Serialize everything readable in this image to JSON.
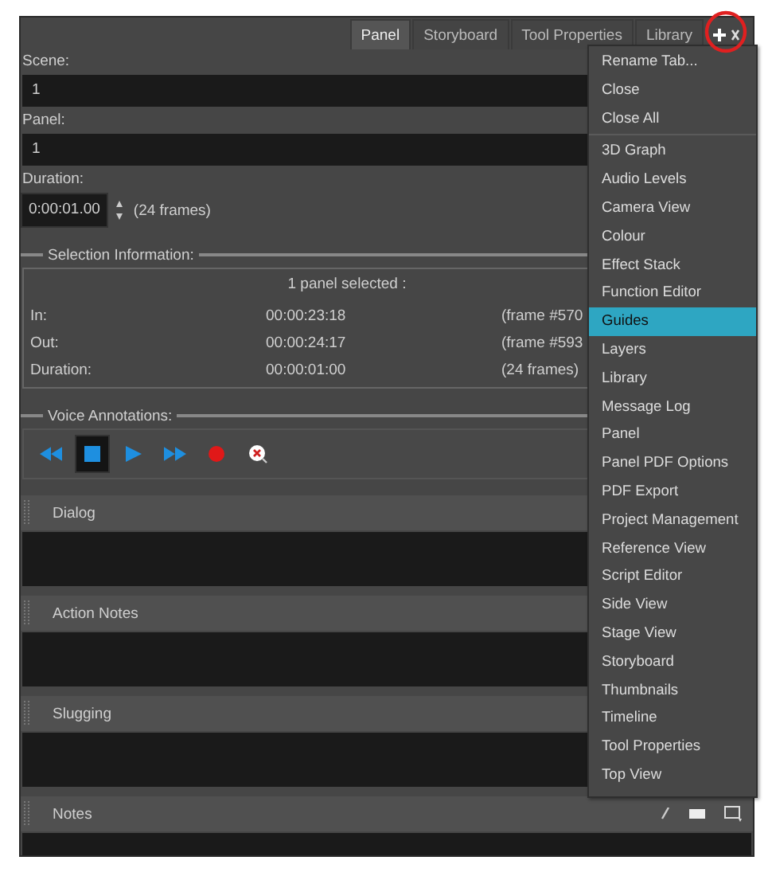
{
  "tabs": [
    {
      "label": "Panel",
      "selected": true
    },
    {
      "label": "Storyboard",
      "selected": false
    },
    {
      "label": "Tool Properties",
      "selected": false
    },
    {
      "label": "Library",
      "selected": false
    }
  ],
  "fields": [
    {
      "label": "Scene:",
      "value": "1"
    },
    {
      "label": "Panel:",
      "value": "1"
    }
  ],
  "duration": {
    "label": "Duration:",
    "value": "0:00:01.00",
    "frames": "(24 frames)"
  },
  "selection_information": {
    "title": "Selection Information:",
    "summary": "1 panel selected :",
    "rows": [
      {
        "label": "In:",
        "time": "00:00:23:18",
        "frame": "(frame #570"
      },
      {
        "label": "Out:",
        "time": "00:00:24:17",
        "frame": "(frame #593"
      },
      {
        "label": "Duration:",
        "time": "00:00:01:00",
        "frame": "(24 frames)"
      }
    ]
  },
  "voice_annotations": {
    "title": "Voice Annotations:",
    "controls": [
      {
        "kind": "rewind",
        "selected": false
      },
      {
        "kind": "stop",
        "selected": true
      },
      {
        "kind": "play",
        "selected": false
      },
      {
        "kind": "forward",
        "selected": false
      },
      {
        "kind": "record",
        "selected": false
      },
      {
        "kind": "delete",
        "selected": false
      }
    ]
  },
  "sections": [
    {
      "title": "Dialog"
    },
    {
      "title": "Action Notes"
    },
    {
      "title": "Slugging"
    },
    {
      "title": "Notes"
    }
  ],
  "menu": {
    "groups": [
      [
        {
          "label": "Rename Tab...",
          "selected": false
        },
        {
          "label": "Close",
          "selected": false
        },
        {
          "label": "Close All",
          "selected": false
        }
      ],
      [
        {
          "label": "3D Graph",
          "selected": false
        },
        {
          "label": "Audio Levels",
          "selected": false
        },
        {
          "label": "Camera View",
          "selected": false
        },
        {
          "label": "Colour",
          "selected": false
        },
        {
          "label": "Effect Stack",
          "selected": false
        },
        {
          "label": "Function Editor",
          "selected": false
        },
        {
          "label": "Guides",
          "selected": true
        },
        {
          "label": "Layers",
          "selected": false
        },
        {
          "label": "Library",
          "selected": false
        },
        {
          "label": "Message Log",
          "selected": false
        },
        {
          "label": "Panel",
          "selected": false
        },
        {
          "label": "Panel PDF Options",
          "selected": false
        },
        {
          "label": "PDF Export",
          "selected": false
        },
        {
          "label": "Project Management",
          "selected": false
        },
        {
          "label": "Reference View",
          "selected": false
        },
        {
          "label": "Script Editor",
          "selected": false
        },
        {
          "label": "Side View",
          "selected": false
        },
        {
          "label": "Stage View",
          "selected": false
        },
        {
          "label": "Storyboard",
          "selected": false
        },
        {
          "label": "Thumbnails",
          "selected": false
        },
        {
          "label": "Timeline",
          "selected": false
        },
        {
          "label": "Tool Properties",
          "selected": false
        },
        {
          "label": "Top View",
          "selected": false
        }
      ]
    ]
  }
}
